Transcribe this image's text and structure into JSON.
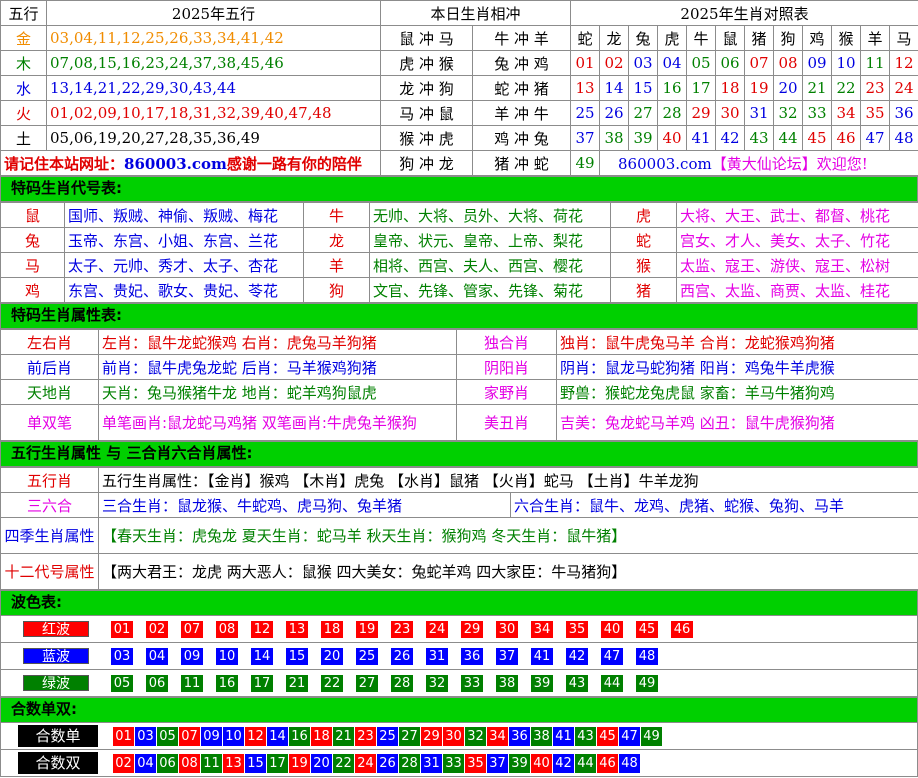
{
  "t1": {
    "h_wx": "五行",
    "h_year_wx": "2025年五行",
    "h_chong": "本日生肖相冲",
    "h_dz": "2025年生肖对照表",
    "rows": [
      {
        "el": "金",
        "nums": "03,04,11,12,25,26,33,34,41,42",
        "c1": "鼠 冲 马",
        "c2": "牛 冲 羊",
        "zod": "蛇",
        "zn": "01"
      },
      {
        "el": "木",
        "nums": "07,08,15,16,23,24,37,38,45,46",
        "c1": "虎 冲 猴",
        "c2": "兔 冲 鸡",
        "zod": "龙",
        "zn": "02"
      },
      {
        "el": "水",
        "nums": "13,14,21,22,29,30,43,44",
        "c1": "龙 冲 狗",
        "c2": "蛇 冲 猪",
        "zod": "兔",
        "zn": "03"
      },
      {
        "el": "火",
        "nums": "01,02,09,10,17,18,31,32,39,40,47,48",
        "c1": "马 冲 鼠",
        "c2": "羊 冲 牛",
        "zod": "虎",
        "zn": "04"
      },
      {
        "el": "土",
        "nums": "05,06,19,20,27,28,35,36,49",
        "c1": "猴 冲 虎",
        "c2": "鸡 冲 兔",
        "zod": "牛",
        "zn": "05"
      }
    ],
    "zodiacs": [
      "蛇",
      "龙",
      "兔",
      "虎",
      "牛",
      "鼠",
      "猪",
      "狗",
      "鸡",
      "猴",
      "羊",
      "马"
    ],
    "zrows": [
      [
        "01",
        "02",
        "03",
        "04",
        "05",
        "06",
        "07",
        "08",
        "09",
        "10",
        "11",
        "12"
      ],
      [
        "13",
        "14",
        "15",
        "16",
        "17",
        "18",
        "19",
        "20",
        "21",
        "22",
        "23",
        "24"
      ],
      [
        "25",
        "26",
        "27",
        "28",
        "29",
        "30",
        "31",
        "32",
        "33",
        "34",
        "35",
        "36"
      ],
      [
        "37",
        "38",
        "39",
        "40",
        "41",
        "42",
        "43",
        "44",
        "45",
        "46",
        "47",
        "48"
      ]
    ],
    "site_text": "请记住本站网址：860003.com感谢一路有你的陪伴",
    "site_url": "860003.com",
    "site_rest": "感谢一路有你的陪伴",
    "site_pre": "请记住本站网址：",
    "last_c1": "狗 冲 龙",
    "last_c2": "猪 冲 蛇",
    "n49": "49",
    "forum_url": "860003.com",
    "forum_name": "【黄大仙论坛】欢迎您!"
  },
  "t2": {
    "title": "特码生肖代号表:",
    "rows": [
      [
        {
          "z": "鼠",
          "d": "国师、叛贼、神偷、叛贼、梅花"
        },
        {
          "z": "牛",
          "d": "无帅、大将、员外、大将、荷花"
        },
        {
          "z": "虎",
          "d": "大将、大王、武士、都督、桃花"
        }
      ],
      [
        {
          "z": "兔",
          "d": "玉帝、东宫、小姐、东宫、兰花"
        },
        {
          "z": "龙",
          "d": "皇帝、状元、皇帝、上帝、梨花"
        },
        {
          "z": "蛇",
          "d": "宫女、才人、美女、太子、竹花"
        }
      ],
      [
        {
          "z": "马",
          "d": "太子、元帅、秀才、太子、杏花"
        },
        {
          "z": "羊",
          "d": "相将、西宫、夫人、西宫、樱花"
        },
        {
          "z": "猴",
          "d": "太监、寇王、游侠、寇王、松树"
        }
      ],
      [
        {
          "z": "鸡",
          "d": "东宫、贵妃、歌女、贵妃、苓花"
        },
        {
          "z": "狗",
          "d": "文官、先锋、管家、先锋、菊花"
        },
        {
          "z": "猪",
          "d": "西宫、太监、商贾、太监、桂花"
        }
      ]
    ]
  },
  "t3": {
    "title": "特码生肖属性表:",
    "rows": [
      {
        "a": "左右肖",
        "b": "左肖：鼠牛龙蛇猴鸡 右肖：虎兔马羊狗猪",
        "c": "独合肖",
        "d": "独肖：鼠牛虎兔马羊 合肖：龙蛇猴鸡狗猪"
      },
      {
        "a": "前后肖",
        "b": "前肖：鼠牛虎兔龙蛇 后肖：马羊猴鸡狗猪",
        "c": "阴阳肖",
        "d": "阴肖：鼠龙马蛇狗猪 阳肖：鸡兔牛羊虎猴"
      },
      {
        "a": "天地肖",
        "b": "天肖：兔马猴猪牛龙 地肖：蛇羊鸡狗鼠虎",
        "c": "家野肖",
        "d": "野兽：猴蛇龙兔虎鼠 家畜：羊马牛猪狗鸡"
      },
      {
        "a": "单双笔",
        "b": "单笔画肖:鼠龙蛇马鸡猪 双笔画肖:牛虎兔羊猴狗",
        "c": "美丑肖",
        "d": "吉美：兔龙蛇马羊鸡 凶丑：鼠牛虎猴狗猪"
      }
    ]
  },
  "t4": {
    "title": "五行生肖属性 与 三合肖六合肖属性:",
    "wx_label": "五行肖",
    "wx_text": "五行生肖属性：【金肖】猴鸡 【木肖】虎兔 【水肖】鼠猪 【火肖】蛇马 【土肖】牛羊龙狗",
    "sl_label": "三六合",
    "sanhe": "三合生肖：鼠龙猴、牛蛇鸡、虎马狗、兔羊猪",
    "liuhe": "六合生肖：鼠牛、龙鸡、虎猪、蛇猴、兔狗、马羊",
    "sj_label": "四季生肖属性",
    "sj_text": "【春天生肖：虎兔龙 夏天生肖：蛇马羊 秋天生肖：猴狗鸡 冬天生肖：鼠牛猪】",
    "sd_label": "十二代号属性",
    "sd_text": "【两大君王：龙虎 两大恶人：鼠猴 四大美女：兔蛇羊鸡 四大家臣：牛马猪狗】"
  },
  "t5": {
    "title": "波色表:",
    "red_label": "红波",
    "blue_label": "蓝波",
    "green_label": "绿波",
    "red": [
      "01",
      "02",
      "07",
      "08",
      "12",
      "13",
      "18",
      "19",
      "23",
      "24",
      "29",
      "30",
      "34",
      "35",
      "40",
      "45",
      "46"
    ],
    "blue": [
      "03",
      "04",
      "09",
      "10",
      "14",
      "15",
      "20",
      "25",
      "26",
      "31",
      "36",
      "37",
      "41",
      "42",
      "47",
      "48"
    ],
    "green": [
      "05",
      "06",
      "11",
      "16",
      "17",
      "21",
      "22",
      "27",
      "28",
      "32",
      "33",
      "38",
      "39",
      "43",
      "44",
      "49"
    ]
  },
  "t6": {
    "title": "合数单双:",
    "odd_label": "合数单",
    "even_label": "合数双",
    "odd": [
      [
        "01",
        "r"
      ],
      [
        "03",
        "b"
      ],
      [
        "05",
        "g"
      ],
      [
        "07",
        "r"
      ],
      [
        "09",
        "b"
      ],
      [
        "10",
        "b"
      ],
      [
        "12",
        "r"
      ],
      [
        "14",
        "b"
      ],
      [
        "16",
        "g"
      ],
      [
        "18",
        "r"
      ],
      [
        "21",
        "g"
      ],
      [
        "23",
        "r"
      ],
      [
        "25",
        "b"
      ],
      [
        "27",
        "g"
      ],
      [
        "29",
        "r"
      ],
      [
        "30",
        "r"
      ],
      [
        "32",
        "g"
      ],
      [
        "34",
        "r"
      ],
      [
        "36",
        "b"
      ],
      [
        "38",
        "g"
      ],
      [
        "41",
        "b"
      ],
      [
        "43",
        "g"
      ],
      [
        "45",
        "r"
      ],
      [
        "47",
        "b"
      ],
      [
        "49",
        "g"
      ]
    ],
    "even": [
      [
        "02",
        "r"
      ],
      [
        "04",
        "b"
      ],
      [
        "06",
        "g"
      ],
      [
        "08",
        "r"
      ],
      [
        "11",
        "g"
      ],
      [
        "13",
        "r"
      ],
      [
        "15",
        "b"
      ],
      [
        "17",
        "g"
      ],
      [
        "19",
        "r"
      ],
      [
        "20",
        "b"
      ],
      [
        "22",
        "g"
      ],
      [
        "24",
        "r"
      ],
      [
        "26",
        "b"
      ],
      [
        "28",
        "g"
      ],
      [
        "31",
        "b"
      ],
      [
        "33",
        "g"
      ],
      [
        "35",
        "r"
      ],
      [
        "37",
        "b"
      ],
      [
        "39",
        "g"
      ],
      [
        "40",
        "r"
      ],
      [
        "42",
        "b"
      ],
      [
        "44",
        "g"
      ],
      [
        "46",
        "r"
      ],
      [
        "48",
        "b"
      ]
    ]
  },
  "colors": {
    "band": "#00d000",
    "red": "#ff0000",
    "blue": "#0000ff",
    "green": "#008000"
  }
}
